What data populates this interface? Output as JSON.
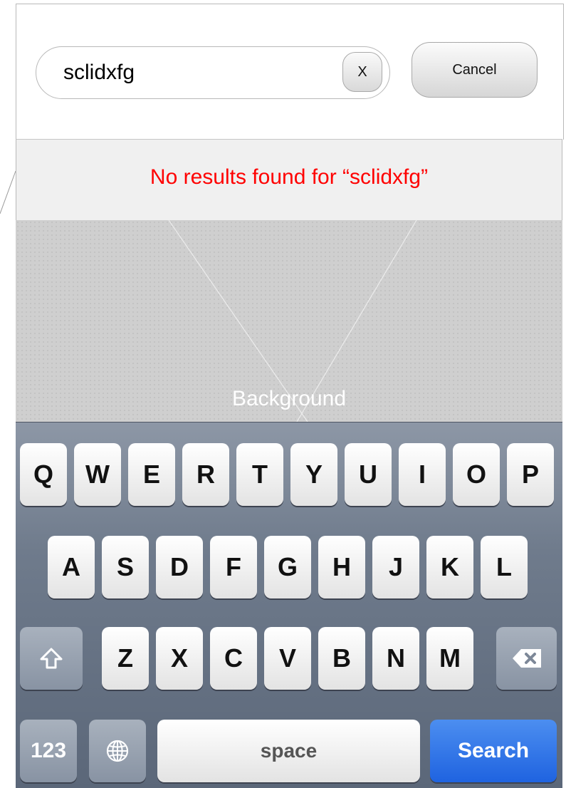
{
  "search": {
    "value": "sclidxfg",
    "clear_label": "X",
    "cancel_label": "Cancel"
  },
  "results": {
    "message": "No results found for “sclidxfg”"
  },
  "placeholder": {
    "label": "Background"
  },
  "keyboard": {
    "row1": [
      "Q",
      "W",
      "E",
      "R",
      "T",
      "Y",
      "U",
      "I",
      "O",
      "P"
    ],
    "row2": [
      "A",
      "S",
      "D",
      "F",
      "G",
      "H",
      "J",
      "K",
      "L"
    ],
    "row3": [
      "Z",
      "X",
      "C",
      "V",
      "B",
      "N",
      "M"
    ],
    "numbers_label": "123",
    "space_label": "space",
    "search_label": "Search",
    "icons": {
      "shift": "shift-icon",
      "delete": "backspace-icon",
      "globe": "globe-icon"
    }
  },
  "colors": {
    "error_text": "#ff0000",
    "search_key": "#1f63e0"
  }
}
